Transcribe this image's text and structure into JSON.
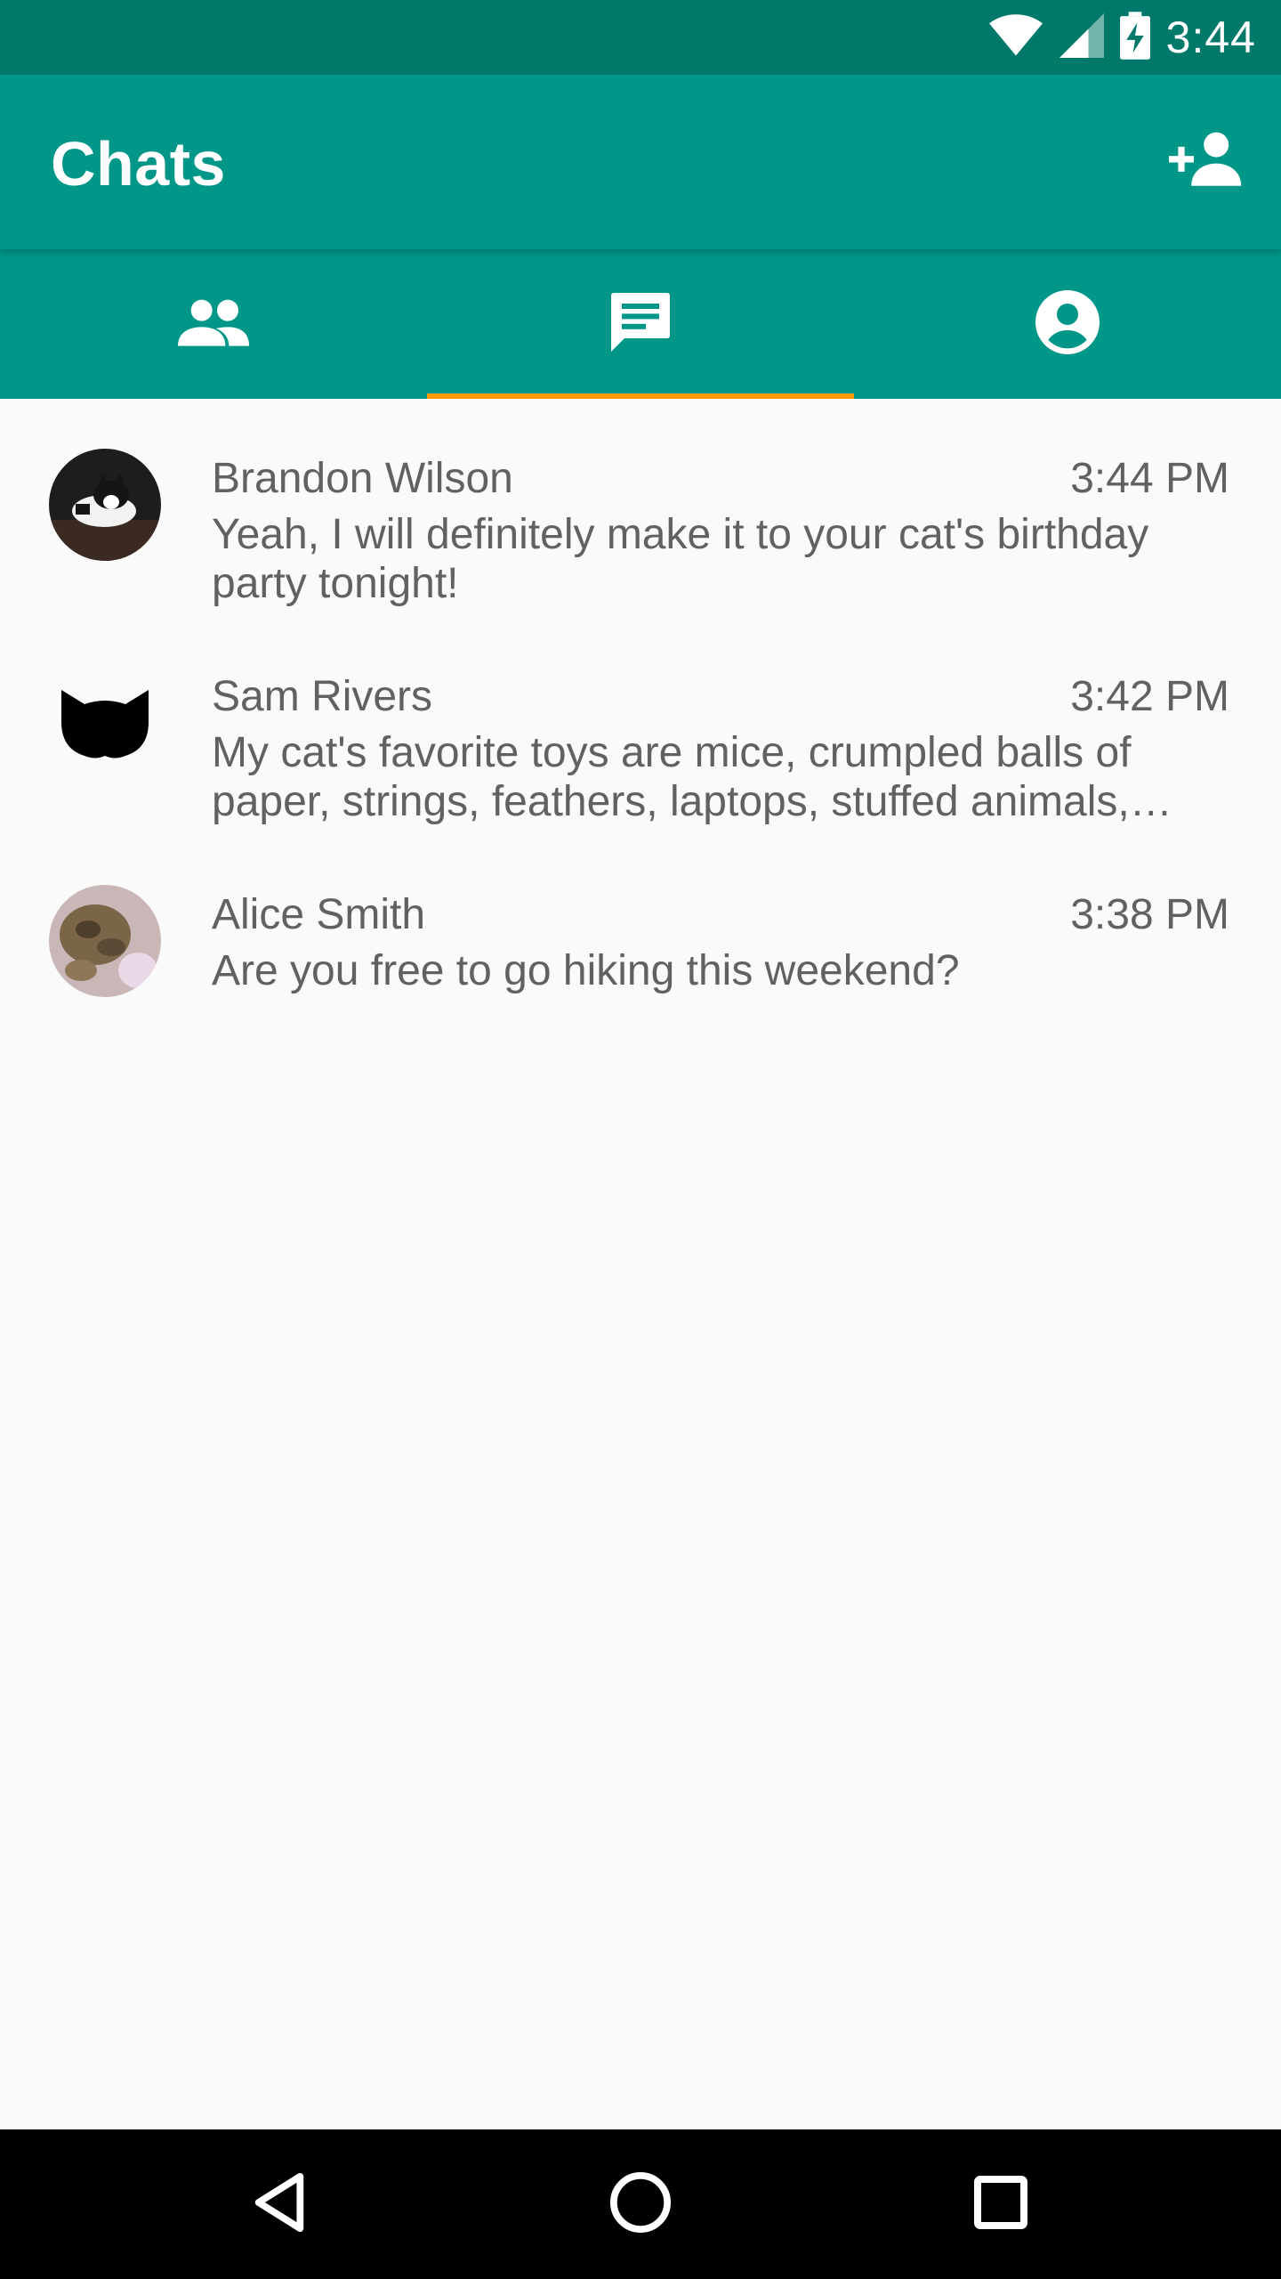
{
  "status_bar": {
    "time": "3:44"
  },
  "app_bar": {
    "title": "Chats"
  },
  "tabs": [
    {
      "icon": "people-icon",
      "selected": false
    },
    {
      "icon": "chat-icon",
      "selected": true
    },
    {
      "icon": "account-circle-icon",
      "selected": false
    }
  ],
  "chats": [
    {
      "name": "Brandon Wilson",
      "time": "3:44 PM",
      "message": "Yeah, I will definitely make it to your cat's birthday party tonight!"
    },
    {
      "name": "Sam Rivers",
      "time": "3:42 PM",
      "message": "My cat's favorite toys are mice, crumpled balls of paper, strings, feathers, laptops, stuffed animals, pillows and more"
    },
    {
      "name": "Alice Smith",
      "time": "3:38 PM",
      "message": "Are you free to go hiking this weekend?"
    }
  ],
  "colors": {
    "primary": "#009688",
    "primary_dark": "#00796b",
    "accent": "#ff9800",
    "background": "#fafafa",
    "text_secondary": "#616161"
  }
}
